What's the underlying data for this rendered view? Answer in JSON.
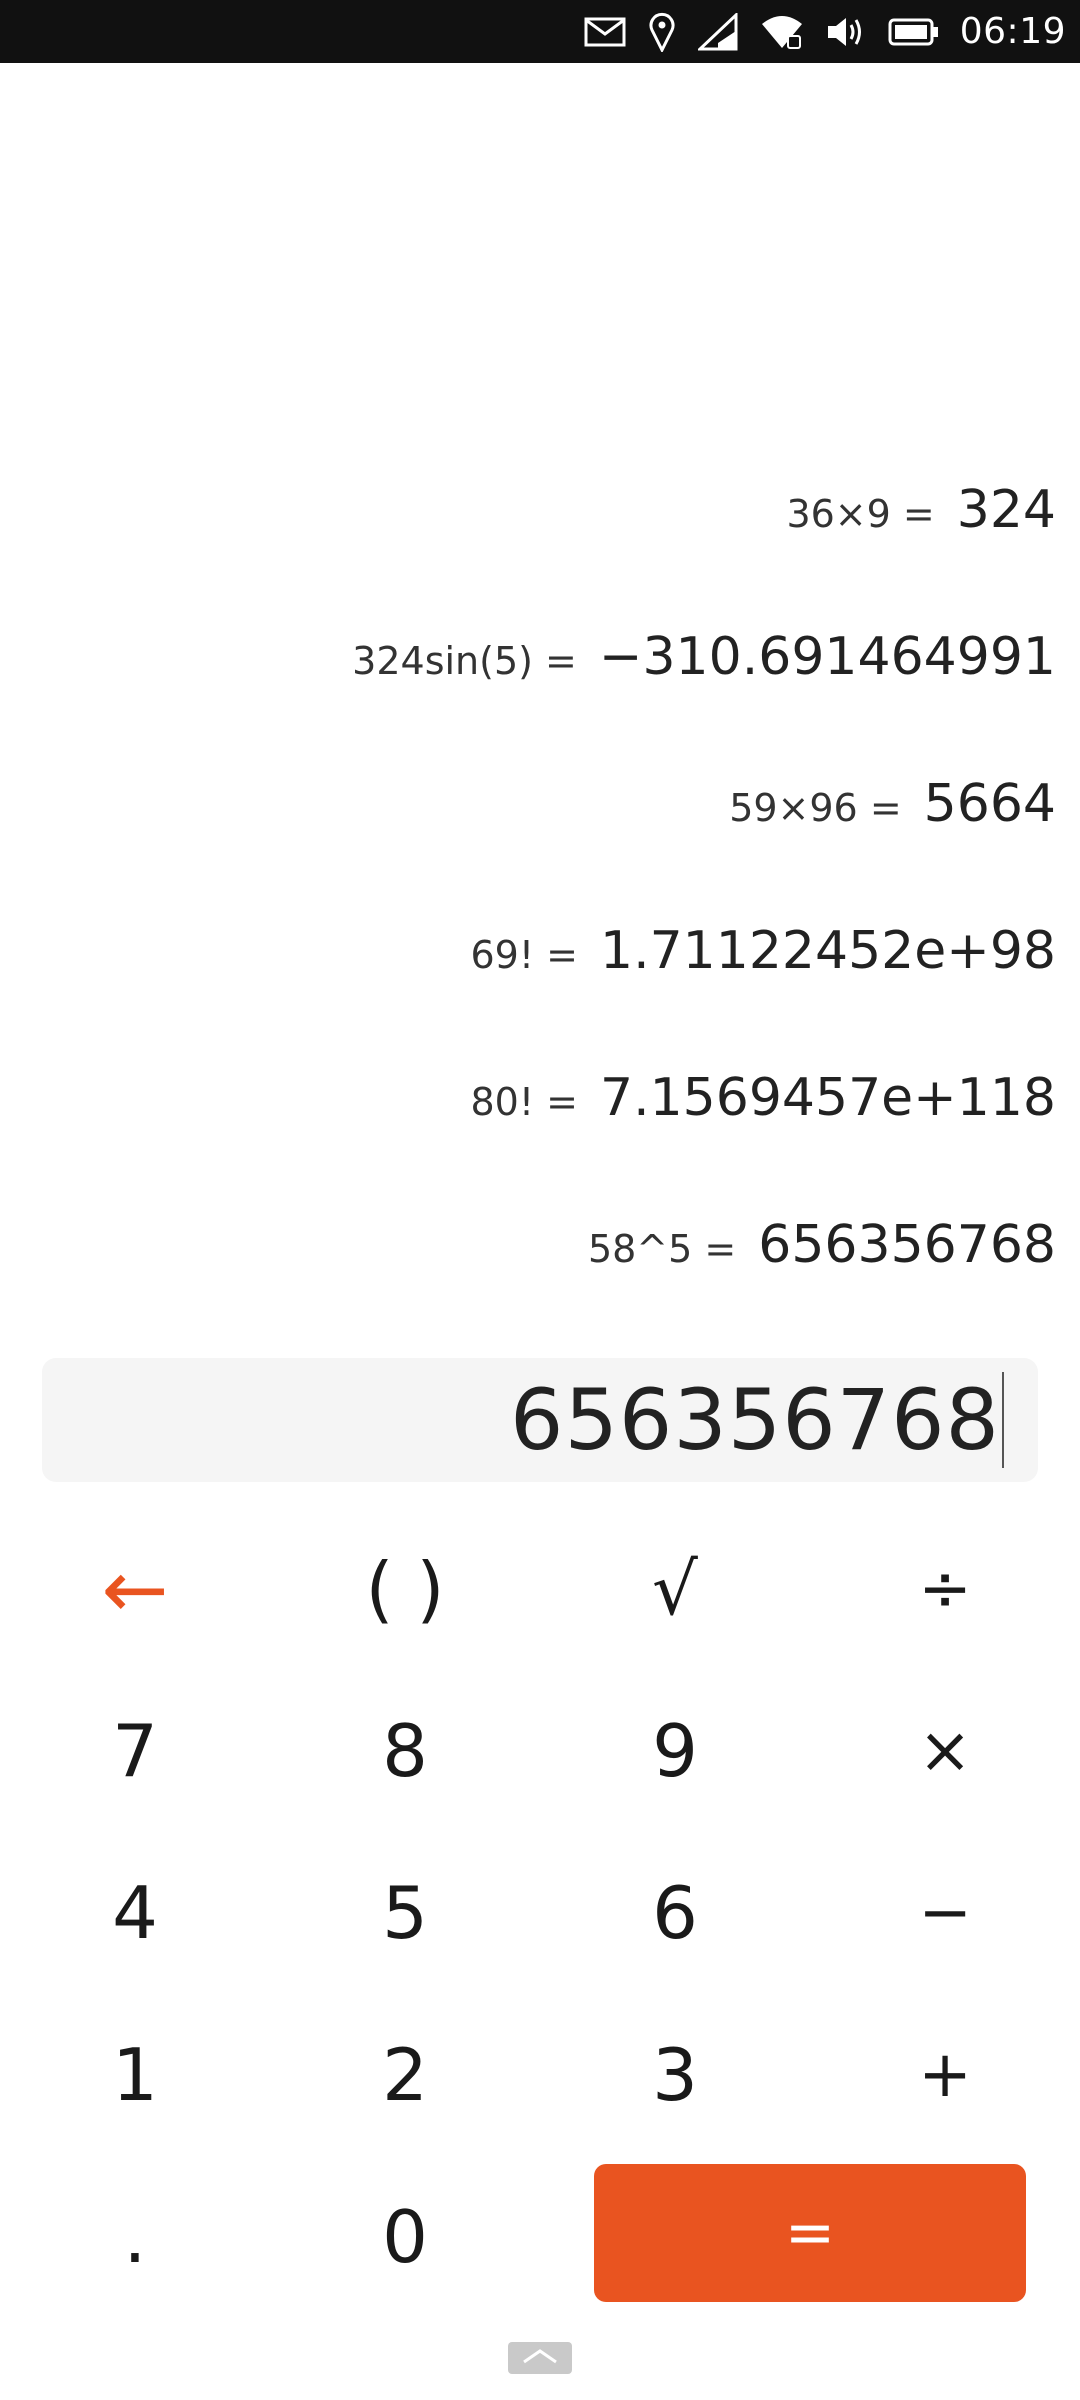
{
  "status_bar": {
    "time": "06:19",
    "icons": [
      "mail-icon",
      "location-icon",
      "signal-icon",
      "wifi-icon",
      "volume-icon",
      "battery-icon"
    ]
  },
  "history": [
    {
      "expr": "36×9 =",
      "result": "324"
    },
    {
      "expr": "324sin(5) =",
      "result": "−310.691464991"
    },
    {
      "expr": "59×96 =",
      "result": "5664"
    },
    {
      "expr": "69! =",
      "result": "1.71122452e+98"
    },
    {
      "expr": "80! =",
      "result": "7.1569457e+118"
    },
    {
      "expr": "58^5 =",
      "result": "656356768"
    }
  ],
  "input": {
    "value": "656356768"
  },
  "keys": {
    "backspace": "←",
    "parens": "( )",
    "sqrt": "√",
    "divide": "÷",
    "seven": "7",
    "eight": "8",
    "nine": "9",
    "multiply": "×",
    "four": "4",
    "five": "5",
    "six": "6",
    "minus": "−",
    "one": "1",
    "two": "2",
    "three": "3",
    "plus": "+",
    "point": ".",
    "zero": "0",
    "equals": "="
  },
  "colors": {
    "accent": "#e95420",
    "status_bar_bg": "#111111",
    "input_bg": "#f5f5f5"
  }
}
